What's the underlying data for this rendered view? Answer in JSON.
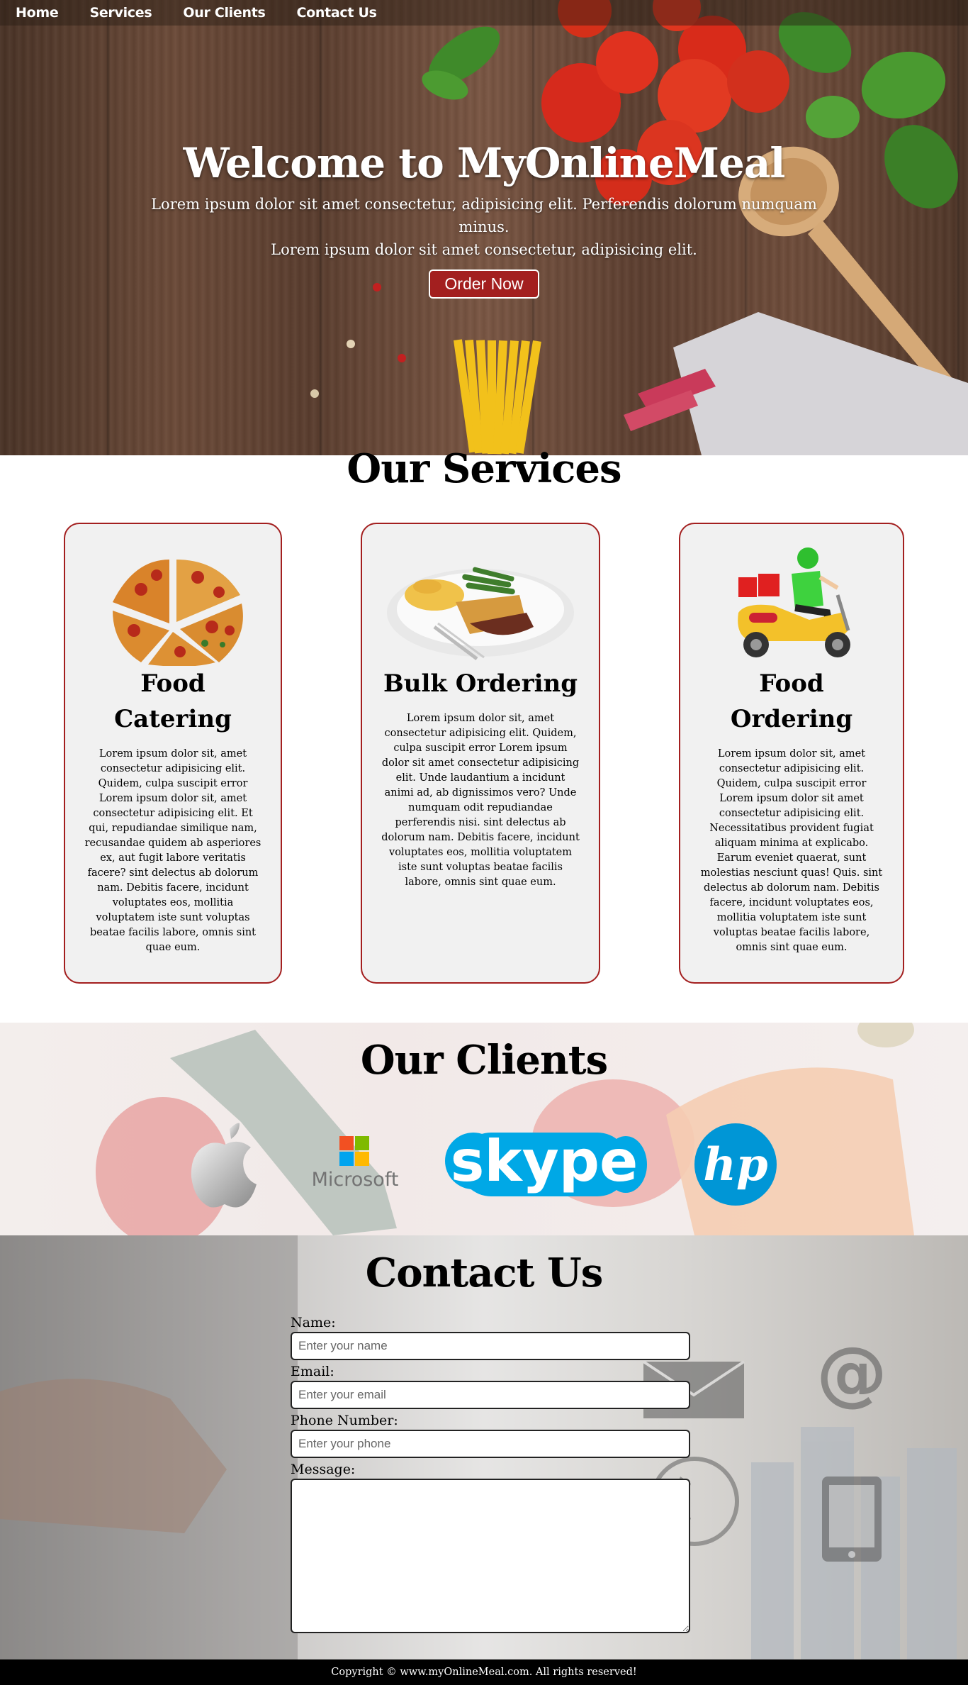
{
  "nav": {
    "items": [
      {
        "label": "Home"
      },
      {
        "label": "Services"
      },
      {
        "label": "Our Clients"
      },
      {
        "label": "Contact Us"
      }
    ]
  },
  "hero": {
    "title": "Welcome to MyOnlineMeal",
    "line1": "Lorem ipsum dolor sit amet consectetur, adipisicing elit. Perferendis dolorum numquam minus.",
    "line2": "Lorem ipsum dolor sit amet consectetur, adipisicing elit.",
    "button_label": "Order Now"
  },
  "services": {
    "title": "Our Services",
    "cards": [
      {
        "title": "Food Catering",
        "icon": "pizza-icon",
        "text": "Lorem ipsum dolor sit, amet consectetur adipisicing elit. Quidem, culpa suscipit error Lorem ipsum dolor sit, amet consectetur adipisicing elit. Et qui, repudiandae similique nam, recusandae quidem ab asperiores ex, aut fugit labore veritatis facere? sint delectus ab dolorum nam. Debitis facere, incidunt voluptates eos, mollitia voluptatem iste sunt voluptas beatae facilis labore, omnis sint quae eum."
      },
      {
        "title": "Bulk Ordering",
        "icon": "meal-plate-icon",
        "text": "Lorem ipsum dolor sit, amet consectetur adipisicing elit. Quidem, culpa suscipit error Lorem ipsum dolor sit amet consectetur adipisicing elit. Unde laudantium a incidunt animi ad, ab dignissimos vero? Unde numquam odit repudiandae perferendis nisi. sint delectus ab dolorum nam. Debitis facere, incidunt voluptates eos, mollitia voluptatem iste sunt voluptas beatae facilis labore, omnis sint quae eum."
      },
      {
        "title": "Food Ordering",
        "icon": "delivery-scooter-icon",
        "text": "Lorem ipsum dolor sit, amet consectetur adipisicing elit. Quidem, culpa suscipit error Lorem ipsum dolor sit amet consectetur adipisicing elit. Necessitatibus provident fugiat aliquam minima at explicabo. Earum eveniet quaerat, sunt molestias nesciunt quas! Quis. sint delectus ab dolorum nam. Debitis facere, incidunt voluptates eos, mollitia voluptatem iste sunt voluptas beatae facilis labore, omnis sint quae eum."
      }
    ]
  },
  "clients": {
    "title": "Our Clients",
    "logos": [
      {
        "name": "apple-logo"
      },
      {
        "name": "microsoft-logo",
        "text": "Microsoft"
      },
      {
        "name": "skype-logo",
        "text": "skype"
      },
      {
        "name": "hp-logo",
        "text": "hp"
      }
    ]
  },
  "contact": {
    "title": "Contact Us",
    "name_label": "Name:",
    "name_placeholder": "Enter your name",
    "email_label": "Email:",
    "email_placeholder": "Enter your email",
    "phone_label": "Phone Number:",
    "phone_placeholder": "Enter your phone",
    "message_label": "Message:"
  },
  "footer": {
    "text": "Copyright © www.myOnlineMeal.com. All rights reserved!"
  },
  "colors": {
    "accent": "#a31f1f",
    "card_bg": "#f1f1f1",
    "footer_bg": "#000000"
  }
}
